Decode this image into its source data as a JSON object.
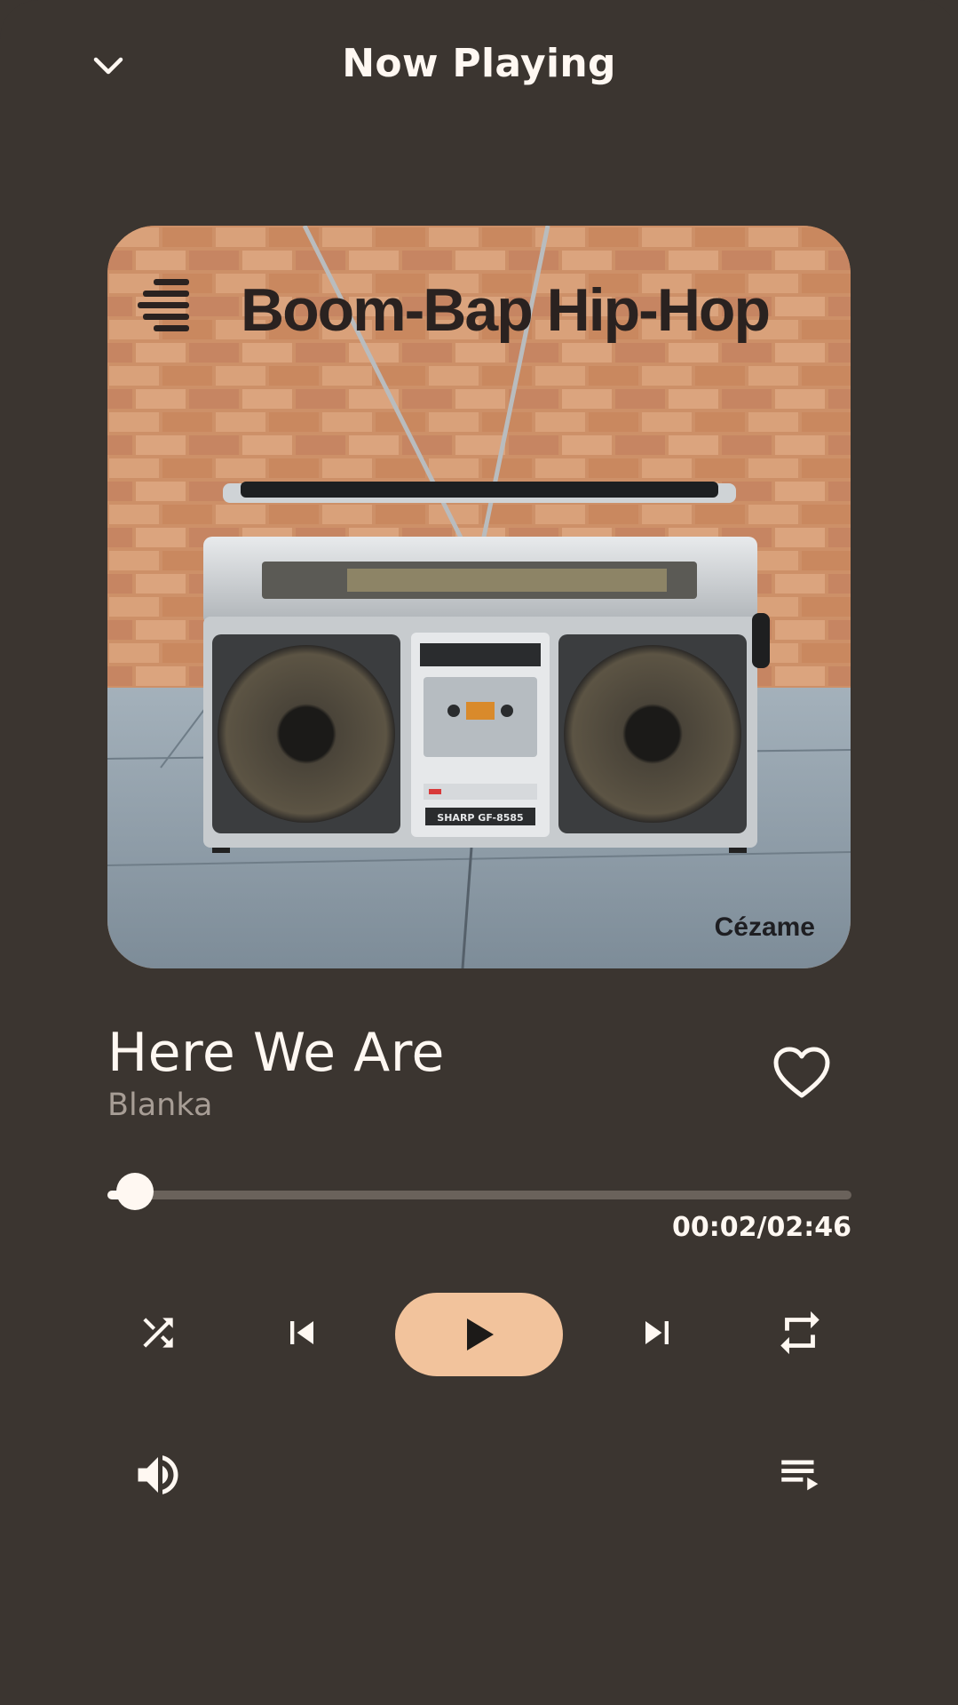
{
  "header": {
    "title": "Now Playing",
    "collapse_icon": "chevron-down-icon"
  },
  "artwork": {
    "playlist_title": "Boom-Bap Hip-Hop",
    "brand": "Cézame",
    "radio_badge": "SHARP GF-8585"
  },
  "track": {
    "title": "Here We Are",
    "artist": "Blanka",
    "liked": false,
    "like_icon": "heart-outline-icon"
  },
  "progress": {
    "elapsed": "00:02",
    "separator": "/",
    "duration": "02:46",
    "fraction": 0.012
  },
  "controls": {
    "shuffle_icon": "shuffle-icon",
    "previous_icon": "skip-previous-icon",
    "play_icon": "play-icon",
    "next_icon": "skip-next-icon",
    "repeat_icon": "repeat-icon",
    "volume_icon": "volume-icon",
    "queue_icon": "queue-icon"
  },
  "colors": {
    "background": "#3b3530",
    "accent": "#f2c39c",
    "text": "#fff8f2",
    "secondary_text": "#a79d95",
    "track": "#6a625b"
  }
}
